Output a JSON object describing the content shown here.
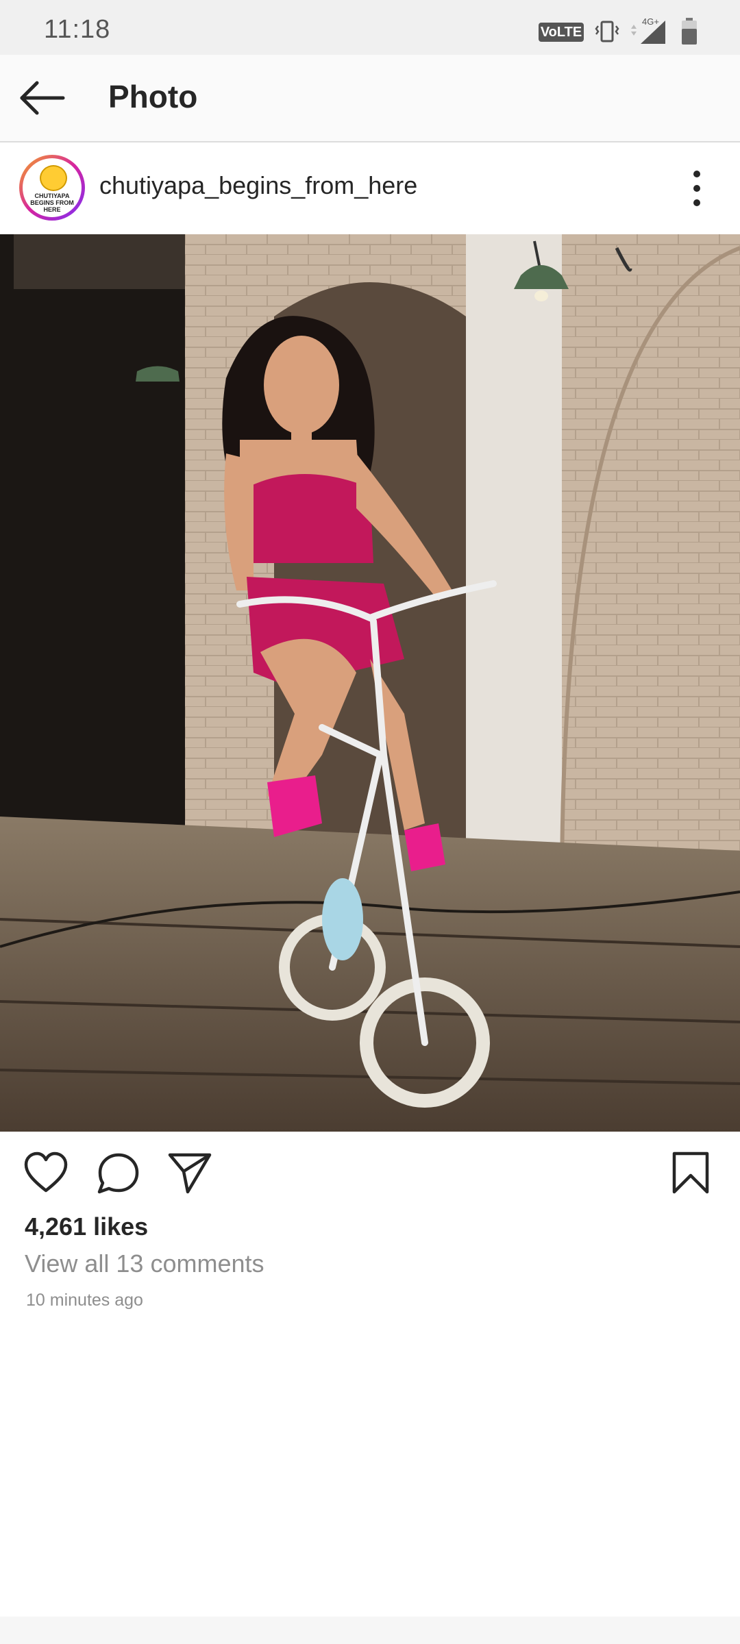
{
  "status_bar": {
    "time": "11:18",
    "volte_label": "VoLTE",
    "network_label": "4G+",
    "icons": [
      "vibrate-icon",
      "signal-icon",
      "battery-icon"
    ]
  },
  "app_bar": {
    "title": "Photo",
    "back_icon": "arrow-left-icon"
  },
  "post": {
    "username": "chutiyapa_begins_from_here",
    "avatar_text": "CHUTIYAPA BEGINS FROM HERE",
    "more_icon": "vertical-dots-icon",
    "photo_description_icon": "photo",
    "actions": {
      "like_icon": "heart-icon",
      "comment_icon": "comment-icon",
      "share_icon": "send-icon",
      "save_icon": "bookmark-icon"
    },
    "likes": "4,261 likes",
    "comments_link": "View all 13 comments",
    "timestamp": "10 minutes ago"
  }
}
